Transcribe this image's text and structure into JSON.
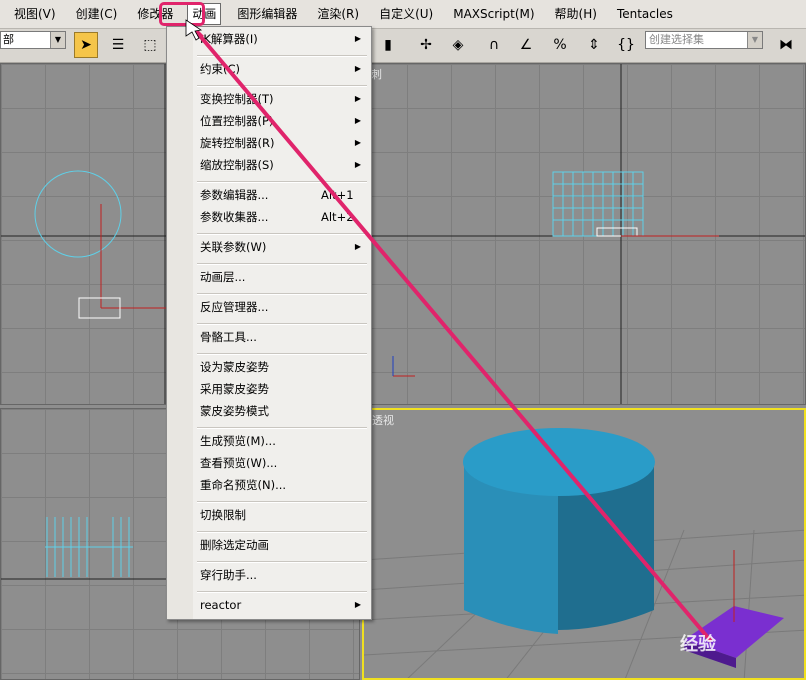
{
  "menubar": {
    "items": [
      "视图(V)",
      "创建(C)",
      "修改器",
      "动画",
      "图形编辑器",
      "渲染(R)",
      "自定义(U)",
      "MAXScript(M)",
      "帮助(H)",
      "Tentacles"
    ],
    "active_index": 3
  },
  "toolbar": {
    "selection_filter": "部",
    "named_selection_placeholder": "创建选择集"
  },
  "viewports": {
    "top_right_label": "刺",
    "bottom_right_label": "透视"
  },
  "menu": {
    "items": [
      {
        "label": "IK解算器(I)",
        "shortcut": "",
        "submenu": true
      },
      {
        "label": "约束(C)",
        "shortcut": "",
        "submenu": true
      },
      {
        "label": "变换控制器(T)",
        "shortcut": "",
        "submenu": true
      },
      {
        "label": "位置控制器(P)",
        "shortcut": "",
        "submenu": true
      },
      {
        "label": "旋转控制器(R)",
        "shortcut": "",
        "submenu": true
      },
      {
        "label": "缩放控制器(S)",
        "shortcut": "",
        "submenu": true
      },
      {
        "label": "参数编辑器...",
        "shortcut": "Alt+1",
        "submenu": false
      },
      {
        "label": "参数收集器...",
        "shortcut": "Alt+2",
        "submenu": false
      },
      {
        "label": "关联参数(W)",
        "shortcut": "",
        "submenu": true
      },
      {
        "label": "动画层...",
        "shortcut": "",
        "submenu": false
      },
      {
        "label": "反应管理器...",
        "shortcut": "",
        "submenu": false
      },
      {
        "label": "骨骼工具...",
        "shortcut": "",
        "submenu": false
      },
      {
        "label": "设为蒙皮姿势",
        "shortcut": "",
        "submenu": false
      },
      {
        "label": "采用蒙皮姿势",
        "shortcut": "",
        "submenu": false
      },
      {
        "label": "蒙皮姿势模式",
        "shortcut": "",
        "submenu": false
      },
      {
        "label": "生成预览(M)...",
        "shortcut": "",
        "submenu": false
      },
      {
        "label": "查看预览(W)...",
        "shortcut": "",
        "submenu": false
      },
      {
        "label": "重命名预览(N)...",
        "shortcut": "",
        "submenu": false
      },
      {
        "label": "切换限制",
        "shortcut": "",
        "submenu": false
      },
      {
        "label": "删除选定动画",
        "shortcut": "",
        "submenu": false
      },
      {
        "label": "穿行助手...",
        "shortcut": "",
        "submenu": false
      },
      {
        "label": "reactor",
        "shortcut": "",
        "submenu": true
      }
    ]
  },
  "watermark": "经验",
  "colors": {
    "highlight": "#e0246b",
    "active_viewport": "#f0e020",
    "cylinder": "#2a8fb8",
    "box": "#7a2fd0",
    "wire": "#5fd0e8"
  }
}
